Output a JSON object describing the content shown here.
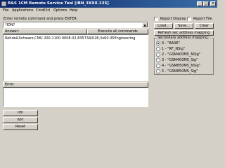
{
  "window": {
    "title": "R&S 1CM Remote Service Tool [IBN_3XXX.135]",
    "minimize_glyph": "_",
    "maximize_glyph": "□",
    "close_glyph": "×"
  },
  "menu": [
    "File",
    "Applications",
    "CmdCtrl",
    "Options",
    "Help"
  ],
  "command": {
    "label": "Enter remote command and press ENTER:",
    "value": "*IDN?",
    "dropdown_glyph": "▼"
  },
  "answer": {
    "header": "Answer:",
    "execute_all_label": "Execute all commands",
    "text": "Rohde&Schwarz,CMU 200-1100.0008.02,835734/028,3x60.05Engineering"
  },
  "error": {
    "header": "Error:",
    "text": ""
  },
  "left_buttons": {
    "idn": "idn",
    "opc": "opc",
    "reset": "Reset"
  },
  "right_panel": {
    "report_display": "Report Display",
    "report_file": "Report File",
    "load": "Load...",
    "save": "Save...",
    "clear": "Clear",
    "refresh": "Refresh sec address mapping",
    "mapping_title": "Secondary address mapping:",
    "mapping_items": [
      "0 - \"BASE\"",
      "1 - \"RF_NSig\"",
      "2 - \"GSM400MS_NSig\"",
      "3 - \"GSM400MS_Sig\"",
      "4 - \"GSM850MS_NSig\"",
      "5 - \"GSM850MS_Sig\""
    ],
    "selected_index": 0
  }
}
